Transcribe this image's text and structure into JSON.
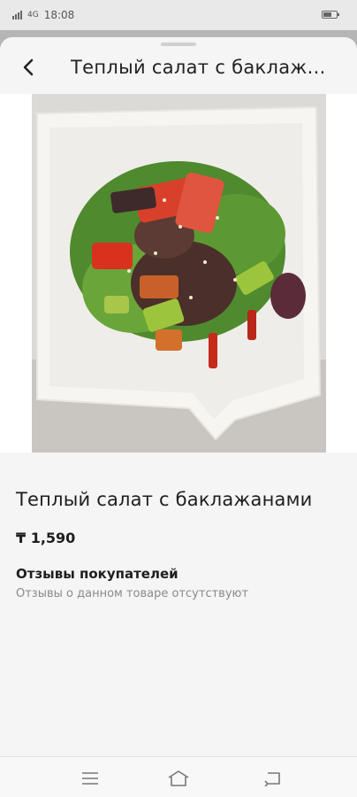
{
  "status_bar": {
    "network_label": "4G",
    "time": "18:08",
    "battery_icon": "battery-icon",
    "signal_icon": "signal-icon"
  },
  "header": {
    "title": "Теплый салат с баклаж...",
    "back_icon": "chevron-left-icon"
  },
  "product": {
    "image_icon": "food-photo",
    "title": "Теплый салат с баклажанами",
    "price": "₸ 1,590"
  },
  "reviews": {
    "heading": "Отзывы покупателей",
    "empty_text": "Отзывы о данном товаре отсутствуют"
  },
  "nav_bar": {
    "menu_icon": "menu-icon",
    "home_icon": "home-icon",
    "back_icon": "back-icon"
  },
  "colors": {
    "sheet_bg": "#f5f5f5",
    "text_primary": "#1e1e1e",
    "text_secondary": "#8a8a8a"
  }
}
